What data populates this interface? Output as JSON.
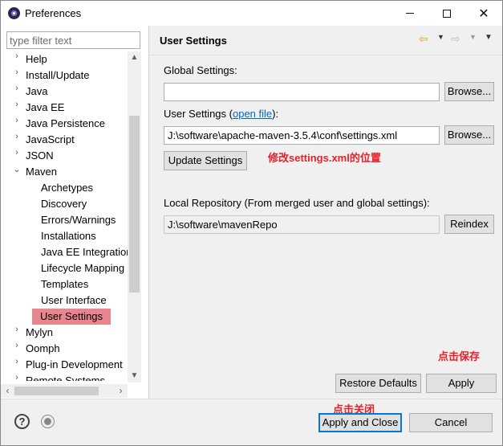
{
  "window": {
    "title": "Preferences",
    "colors": {
      "selection": "#e9858e",
      "annotation": "#e8202a",
      "link": "#0066cc",
      "primary_border": "#0078d7"
    }
  },
  "filter": {
    "placeholder": "type filter text",
    "value": ""
  },
  "tree": {
    "items": [
      {
        "label": "Help",
        "chevron": "›"
      },
      {
        "label": "Install/Update",
        "chevron": "›"
      },
      {
        "label": "Java",
        "chevron": "›"
      },
      {
        "label": "Java EE",
        "chevron": "›"
      },
      {
        "label": "Java Persistence",
        "chevron": "›"
      },
      {
        "label": "JavaScript",
        "chevron": "›"
      },
      {
        "label": "JSON",
        "chevron": "›"
      },
      {
        "label": "Maven",
        "chevron": "⌄"
      },
      {
        "label": "Archetypes"
      },
      {
        "label": "Discovery"
      },
      {
        "label": "Errors/Warnings"
      },
      {
        "label": "Installations"
      },
      {
        "label": "Java EE Integration"
      },
      {
        "label": "Lifecycle Mapping"
      },
      {
        "label": "Templates"
      },
      {
        "label": "User Interface"
      },
      {
        "label": "User Settings",
        "selected": true
      },
      {
        "label": "Mylyn",
        "chevron": "›"
      },
      {
        "label": "Oomph",
        "chevron": "›"
      },
      {
        "label": "Plug-in Development",
        "chevron": "›"
      },
      {
        "label": "Remote Systems",
        "chevron": "›"
      }
    ]
  },
  "page": {
    "title": "User Settings",
    "global_settings_label": "Global Settings:",
    "global_settings_value": "",
    "browse_label": "Browse...",
    "user_settings_label": "User Settings (",
    "open_file_link": "open file",
    "user_settings_label_end": "):",
    "user_settings_value": "J:\\software\\apache-maven-3.5.4\\conf\\settings.xml",
    "update_settings_label": "Update Settings",
    "local_repo_label": "Local Repository (From merged user and global settings):",
    "local_repo_value": "J:\\software\\mavenRepo",
    "reindex_label": "Reindex",
    "restore_defaults_label": "Restore Defaults",
    "apply_label": "Apply"
  },
  "annotations": {
    "modify_location": "修改settings.xml的位置",
    "click_save": "点击保存",
    "click_close": "点击关闭"
  },
  "footer": {
    "apply_close_label": "Apply and Close",
    "cancel_label": "Cancel"
  }
}
